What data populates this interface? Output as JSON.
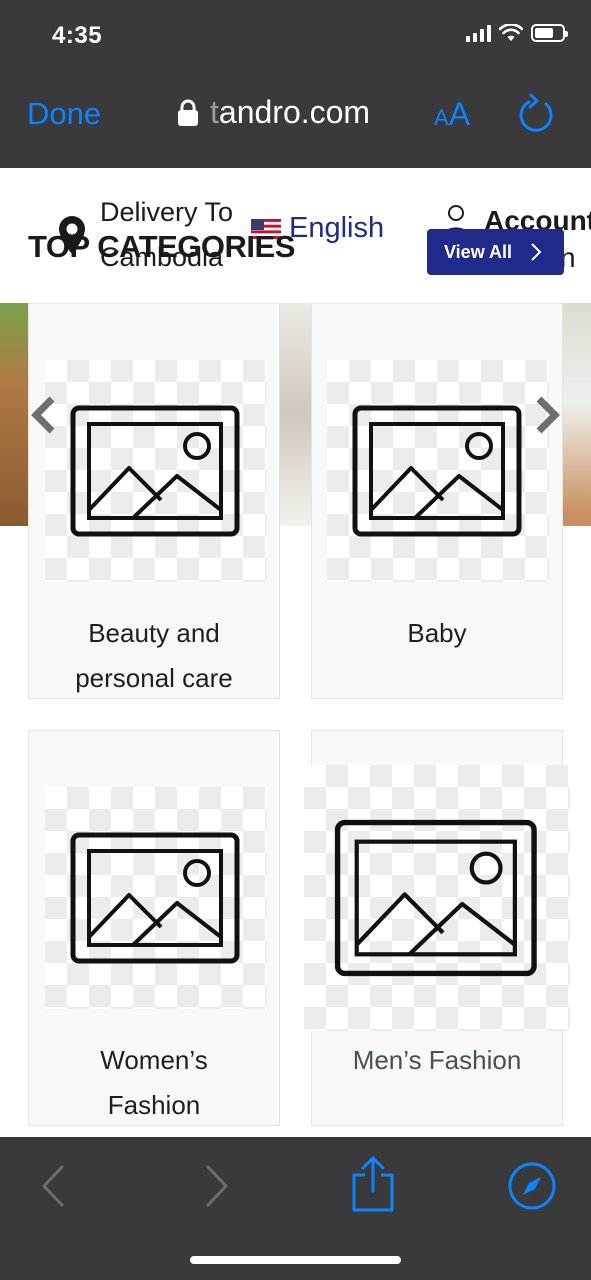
{
  "status_bar": {
    "time": "4:35"
  },
  "browser": {
    "done_label": "Done",
    "url_dim": "t",
    "url_rest": "andro.com",
    "text_size_label_small": "A",
    "text_size_label_large": "A"
  },
  "site_header": {
    "delivery_label": "Delivery To",
    "delivery_country": "Cambodia",
    "language": "English",
    "account_label": "Account",
    "account_sub": "n"
  },
  "categories": {
    "title": "TOP CATEGORIES",
    "view_all_label": "View All",
    "items": [
      {
        "line1": "Beauty and",
        "line2": "personal care"
      },
      {
        "line1": "Baby",
        "line2": ""
      },
      {
        "line1": "Women’s",
        "line2": "Fashion"
      },
      {
        "line1": "Men’s Fashion",
        "line2": ""
      }
    ]
  },
  "icons": [
    "lock-icon",
    "reload-icon",
    "location-pin-icon",
    "us-flag-icon",
    "user-icon",
    "chevron-right-icon",
    "chevron-left-icon",
    "image-placeholder-icon",
    "back-icon",
    "forward-icon",
    "share-icon",
    "compass-icon"
  ],
  "colors": {
    "accent": "#0a84ff",
    "brand": "#1f2a8a",
    "chrome": "#3a3a3c"
  }
}
